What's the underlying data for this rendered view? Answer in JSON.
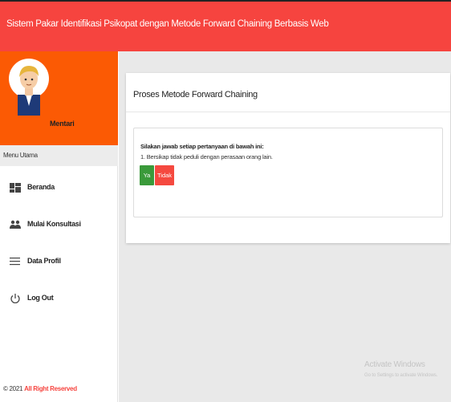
{
  "header": {
    "title": "Sistem Pakar Identifikasi Psikopat dengan Metode Forward Chaining Berbasis Web"
  },
  "sidebar": {
    "user_name": "Mentari",
    "menu_header": "Menu Utama",
    "items": [
      {
        "label": "Beranda",
        "icon": "dashboard-icon"
      },
      {
        "label": "Mulai Konsultasi",
        "icon": "users-icon"
      },
      {
        "label": "Data Profil",
        "icon": "list-icon"
      },
      {
        "label": "Log Out",
        "icon": "power-icon"
      }
    ],
    "footer": {
      "copyright": "© 2021",
      "reserved": "All Right Reserved"
    }
  },
  "main": {
    "card_title": "Proses Metode Forward Chaining",
    "prompt": "Silakan jawab setiap pertanyaan di bawah ini:",
    "question": "1. Bersikap tidak peduli dengan perasaan orang lain.",
    "yes_label": "Ya",
    "no_label": "Tidak"
  },
  "watermark": {
    "line1": "Activate Windows",
    "line2": "Go to Settings to activate Windows."
  },
  "colors": {
    "topbar": "#f6443f",
    "profile_bg": "#fb5a04",
    "yes": "#3a9a3a",
    "no": "#f5493f"
  }
}
